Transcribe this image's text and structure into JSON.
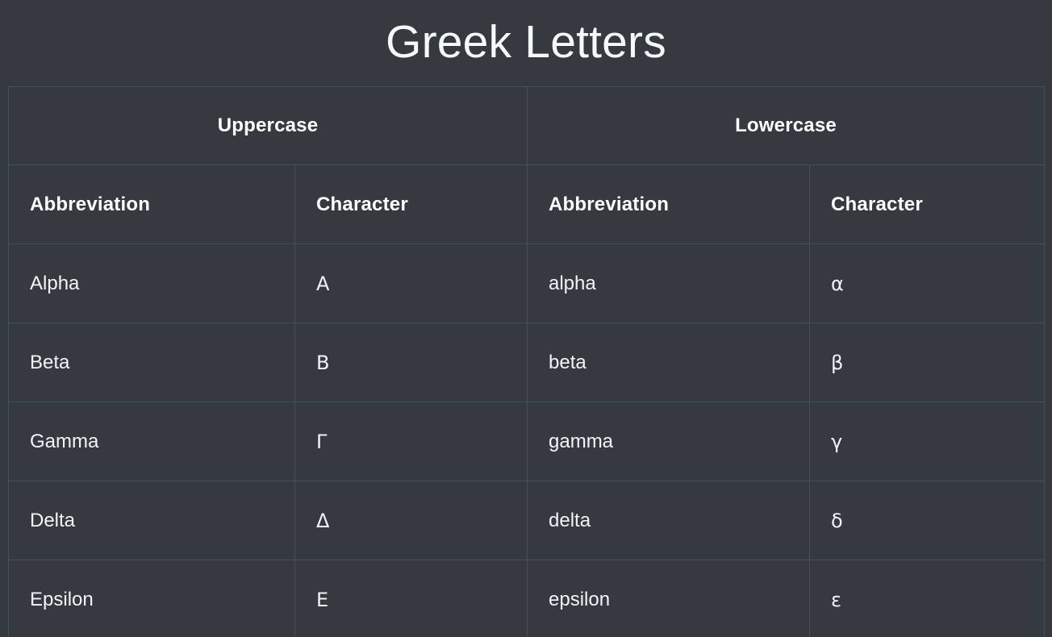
{
  "page": {
    "title": "Greek Letters",
    "background_color": "#343a40",
    "text_color": "#f2f4f6",
    "border_color": "#495057"
  },
  "table": {
    "group_headers": [
      {
        "label": "Uppercase",
        "span": 2
      },
      {
        "label": "Lowercase",
        "span": 2
      }
    ],
    "column_headers": [
      "Abbreviation",
      "Character",
      "Abbreviation",
      "Character"
    ],
    "rows": [
      {
        "uppercase_abbreviation": "Alpha",
        "uppercase_character": "Α",
        "lowercase_abbreviation": "alpha",
        "lowercase_character": "α"
      },
      {
        "uppercase_abbreviation": "Beta",
        "uppercase_character": "Β",
        "lowercase_abbreviation": "beta",
        "lowercase_character": "β"
      },
      {
        "uppercase_abbreviation": "Gamma",
        "uppercase_character": "Γ",
        "lowercase_abbreviation": "gamma",
        "lowercase_character": "γ"
      },
      {
        "uppercase_abbreviation": "Delta",
        "uppercase_character": "Δ",
        "lowercase_abbreviation": "delta",
        "lowercase_character": "δ"
      },
      {
        "uppercase_abbreviation": "Epsilon",
        "uppercase_character": "Ε",
        "lowercase_abbreviation": "epsilon",
        "lowercase_character": "ε"
      }
    ]
  }
}
